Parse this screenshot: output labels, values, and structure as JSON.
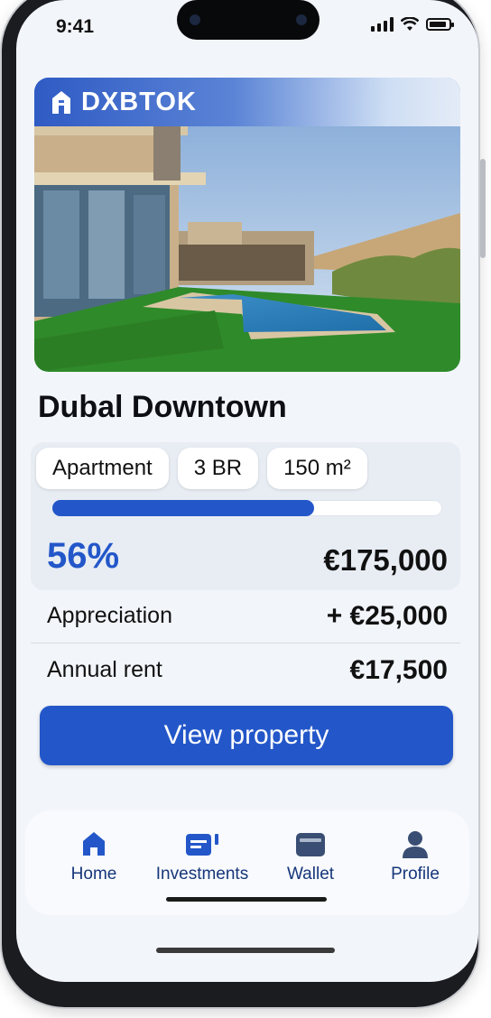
{
  "status_bar": {
    "time": "9:41"
  },
  "brand": {
    "name": "DXBTOK"
  },
  "property": {
    "title": "Dubal Downtown",
    "chips": [
      "Apartment",
      "3 BR",
      "150 m²"
    ],
    "funded_percent": 56,
    "funded_label": "56%",
    "price": "€175,000"
  },
  "stats": [
    {
      "label": "Appreciation",
      "value": "+ €25,000"
    },
    {
      "label": "Annual rent",
      "value": "€17,500"
    }
  ],
  "cta": {
    "label": "View property"
  },
  "tabbar": {
    "items": [
      {
        "label": "Home",
        "icon": "home-icon"
      },
      {
        "label": "Investments",
        "icon": "investments-icon"
      },
      {
        "label": "Wallet",
        "icon": "wallet-icon"
      },
      {
        "label": "Profile",
        "icon": "profile-icon"
      }
    ]
  },
  "colors": {
    "accent": "#2357c9",
    "nav_text": "#16367a"
  }
}
